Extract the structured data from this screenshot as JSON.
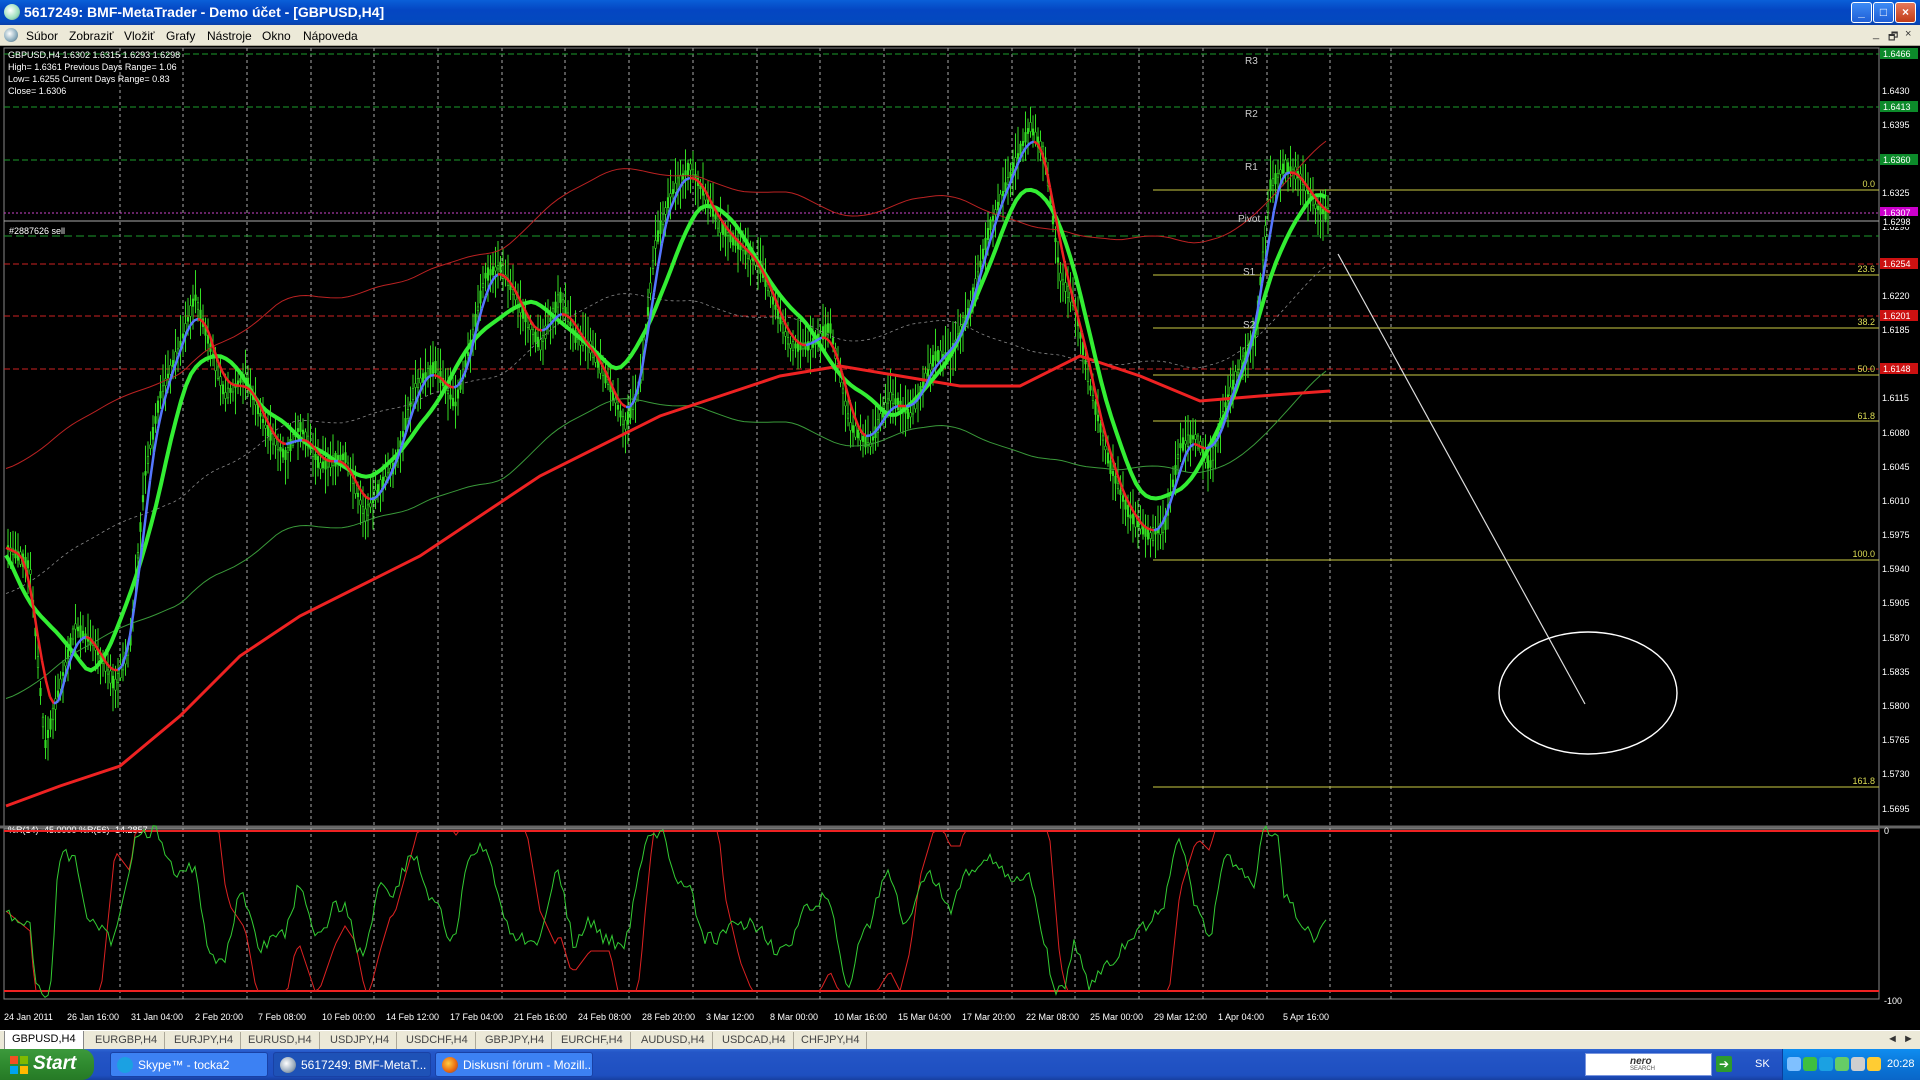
{
  "window": {
    "title": "5617249: BMF-MetaTrader - Demo účet - [GBPUSD,H4]",
    "controls": [
      "_",
      "□",
      "×"
    ]
  },
  "menu": {
    "items": [
      "Súbor",
      "Zobraziť",
      "Vložiť",
      "Grafy",
      "Nástroje",
      "Okno",
      "Nápoveda"
    ],
    "mdi_controls": [
      "_",
      "🗗",
      "×"
    ]
  },
  "chart": {
    "symbol": "GBPUSD",
    "timeframe": "H4",
    "info_lines": [
      "GBPUSD,H4  1.6302  1.6315  1.6293  1.6298",
      "High= 1.6361     Previous Days Range= 1.06",
      "Low= 1.6255      Current Days Range= 0.83",
      "Close= 1.6306"
    ],
    "order_label": "#2887626 sell",
    "pivot_labels": [
      "R3",
      "R2",
      "R1",
      "Pivot",
      "S1",
      "S2"
    ],
    "fib_labels": [
      "0.0",
      "23.6",
      "38.2",
      "50.0",
      "61.8",
      "100.0",
      "161.8"
    ],
    "price_ticks": [
      "1.6430",
      "1.6395",
      "1.6325",
      "1.6290",
      "1.6220",
      "1.6185",
      "1.6115",
      "1.6080",
      "1.6045",
      "1.6010",
      "1.5975",
      "1.5940",
      "1.5905",
      "1.5870",
      "1.5835",
      "1.5800",
      "1.5765",
      "1.5730",
      "1.5695"
    ],
    "price_tags": [
      {
        "text": "1.6466",
        "color": "#0c8a2a"
      },
      {
        "text": "1.6413",
        "color": "#0c8a2a"
      },
      {
        "text": "1.6360",
        "color": "#0c8a2a"
      },
      {
        "text": "1.6307",
        "color": "#cc00cc"
      },
      {
        "text": "1.6298",
        "color": "#000000"
      },
      {
        "text": "1.6254",
        "color": "#cc1111"
      },
      {
        "text": "1.6201",
        "color": "#cc1111"
      },
      {
        "text": "1.6148",
        "color": "#cc1111"
      }
    ],
    "time_labels": [
      "24 Jan 2011",
      "26 Jan 16:00",
      "31 Jan 04:00",
      "2 Feb 20:00",
      "7 Feb 08:00",
      "10 Feb 00:00",
      "14 Feb 12:00",
      "17 Feb 04:00",
      "21 Feb 16:00",
      "24 Feb 08:00",
      "28 Feb 20:00",
      "3 Mar 12:00",
      "8 Mar 00:00",
      "10 Mar 16:00",
      "15 Mar 04:00",
      "17 Mar 20:00",
      "22 Mar 08:00",
      "25 Mar 00:00",
      "29 Mar 12:00",
      "1 Apr 04:00",
      "5 Apr 16:00"
    ],
    "indicator_label": "%R(14) -45.0000  %R(56) -14.2857",
    "indicator_scale": [
      "0",
      "-100"
    ],
    "colors": {
      "candles": "#33dd22",
      "ma_fast_up": "#5577ff",
      "ma_fast_down": "#ee2222",
      "ma_mid": "#33ee33",
      "ma_slow": "#ee2222",
      "fib": "#cccc44",
      "grid": "#aaaaaa"
    }
  },
  "tabs": {
    "items": [
      "GBPUSD,H4",
      "EURGBP,H4",
      "EURJPY,H4",
      "EURUSD,H4",
      "USDJPY,H4",
      "USDCHF,H4",
      "GBPJPY,H4",
      "EURCHF,H4",
      "AUDUSD,H4",
      "USDCAD,H4",
      "CHFJPY,H4"
    ],
    "active": "GBPUSD,H4",
    "scroll": [
      "◄",
      "►"
    ]
  },
  "taskbar": {
    "start_label": "Start",
    "tasks": [
      {
        "label": "Skype™ - tocka2",
        "active": false
      },
      {
        "label": "5617249: BMF-MetaT...",
        "active": true
      },
      {
        "label": "Diskusní fórum - Mozill...",
        "active": false
      }
    ],
    "search_brand": "nero",
    "search_sub": "SEARCH",
    "go_label": "➔",
    "language": "SK",
    "clock": "20:28"
  }
}
